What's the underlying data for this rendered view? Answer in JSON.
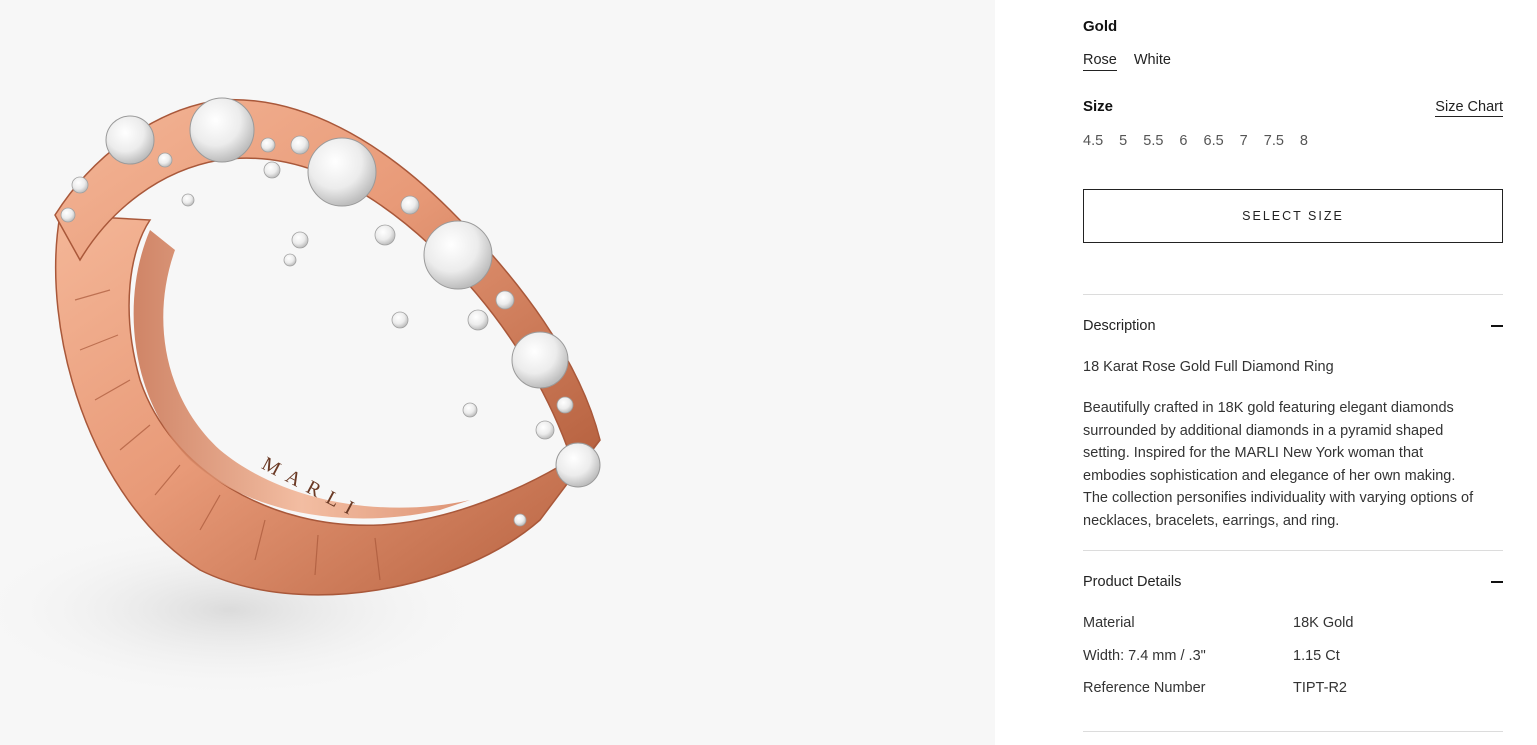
{
  "product_image": {
    "alt": "18 Karat Rose Gold Full Diamond Ring",
    "engraving": "MARLI"
  },
  "gold": {
    "title": "Gold",
    "options": [
      "Rose",
      "White"
    ],
    "selected": "Rose"
  },
  "size": {
    "title": "Size",
    "chart_link": "Size Chart",
    "options": [
      "4.5",
      "5",
      "5.5",
      "6",
      "6.5",
      "7",
      "7.5",
      "8"
    ]
  },
  "select_size_button": "SELECT SIZE",
  "description": {
    "title": "Description",
    "subtitle": "18 Karat Rose Gold Full Diamond Ring",
    "body": "Beautifully crafted in 18K gold featuring elegant diamonds surrounded by additional diamonds in a pyramid shaped setting. Inspired for the MARLI New York woman that embodies sophistication and elegance of her own making. The collection personifies individuality with varying options of necklaces, bracelets, earrings, and ring."
  },
  "product_details": {
    "title": "Product Details",
    "rows": [
      {
        "label": "Material",
        "value": "18K Gold"
      },
      {
        "label": "Width: 7.4 mm / .3\"",
        "value": "1.15 Ct"
      },
      {
        "label": "Reference Number",
        "value": "TIPT-R2"
      }
    ]
  },
  "colors": {
    "rose_gold": "#e89a78",
    "rose_gold_dark": "#b5603e",
    "diamond": "#f2f2f2",
    "divider": "#dcdcdc"
  }
}
